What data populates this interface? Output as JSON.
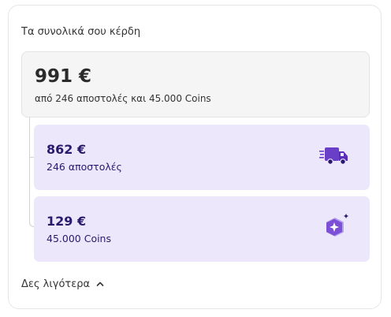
{
  "earnings": {
    "heading": "Τα συνολικά σου κέρδη",
    "total": {
      "amount": "991 €",
      "subtitle": "από 246 αποστολές και 45.000 Coins"
    },
    "items": [
      {
        "amount": "862 €",
        "label": "246 αποστολές",
        "icon": "delivery-truck-icon"
      },
      {
        "amount": "129 €",
        "label": "45.000 Coins",
        "icon": "coins-icon"
      }
    ],
    "toggle_label": "Δες λιγότερα",
    "accent_color": "#6a3fc8",
    "item_background": "#ece7fb"
  }
}
